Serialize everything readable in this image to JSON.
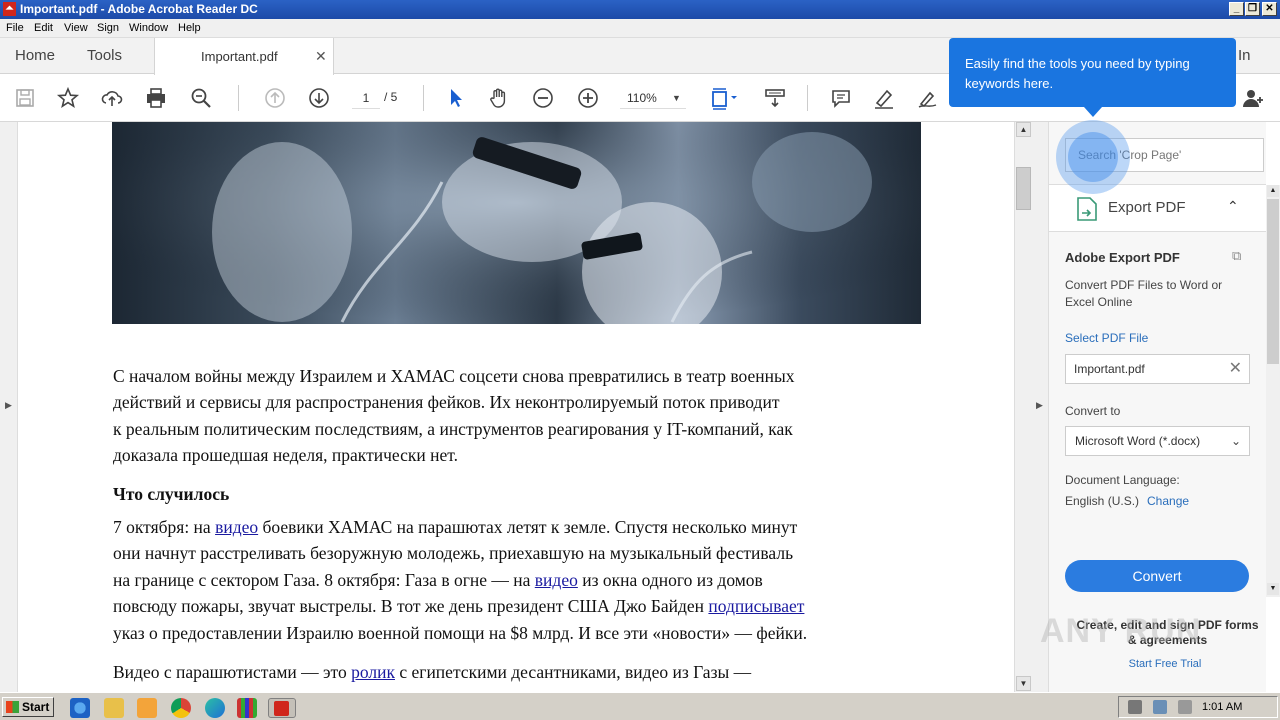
{
  "window": {
    "title": "Important.pdf - Adobe Acrobat Reader DC"
  },
  "menu": [
    "File",
    "Edit",
    "View",
    "Sign",
    "Window",
    "Help"
  ],
  "tabs": {
    "home": "Home",
    "tools": "Tools",
    "document": "Important.pdf",
    "signin": "In"
  },
  "toolbar": {
    "page_current": "1",
    "page_total": "/ 5",
    "zoom": "110%"
  },
  "tooltip": {
    "text": "Easily find the tools you need by typing keywords here."
  },
  "right_panel": {
    "search_placeholder": "Search 'Crop Page'",
    "section": "Export PDF",
    "title": "Adobe Export PDF",
    "description": "Convert PDF Files to Word or Excel Online",
    "select_label": "Select PDF File",
    "selected_file": "Important.pdf",
    "convert_to_label": "Convert to",
    "convert_to_value": "Microsoft Word (*.docx)",
    "lang_label": "Document Language:",
    "lang_value": "English (U.S.)",
    "change_link": "Change",
    "convert_button": "Convert",
    "create_text": "Create, edit and sign PDF forms & agreements",
    "trial_link": "Start Free Trial"
  },
  "document": {
    "p1": [
      "С началом войны между Израилем и ХАМАС соцсети снова превратились в театр военных",
      "действий и сервисы для распространения фейков. Их неконтролируемый поток приводит",
      "к реальным политическим последствиям, а инструментов реагирования у IT-компаний, как",
      "доказала прошедшая неделя, практически нет."
    ],
    "heading": "Что случилось",
    "p2": {
      "l1a": "7 октября: на ",
      "l1b": "видео",
      "l1c": " боевики ХАМАС на парашютах летят к земле. Спустя несколько минут",
      "l2": "они начнут расстреливать безоружную молодежь, приехавшую на музыкальный фестиваль",
      "l3a": "на границе с сектором Газа. 8 октября: Газа в огне — на ",
      "l3b": "видео",
      "l3c": " из окна одного из домов",
      "l4a": "повсюду пожары, звучат выстрелы. В тот же день президент США Джо Байден ",
      "l4b": "подписывает",
      "l5": "указ о предоставлении Израилю военной помощи на $8 млрд. И все эти «новости» — фейки."
    },
    "p3": {
      "a": "Видео с парашютистами — это ",
      "b": "ролик",
      "c": " с египетскими десантниками, видео из Газы —"
    }
  },
  "watermark": "ANY RUN",
  "taskbar": {
    "start": "Start",
    "clock": "1:01 AM"
  }
}
